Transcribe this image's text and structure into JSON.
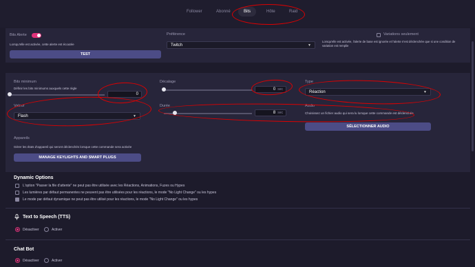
{
  "tabs": [
    {
      "label": "Follower",
      "active": false
    },
    {
      "label": "Abonné",
      "active": false
    },
    {
      "label": "Bits",
      "active": true
    },
    {
      "label": "Hôte",
      "active": false
    },
    {
      "label": "Raid",
      "active": false
    }
  ],
  "alert": {
    "title": "Bits Alerte",
    "enabled": true,
    "description": "Lorsqu'elle est activée, cette alerte est écoutée",
    "test_label": "TEST"
  },
  "preference": {
    "label": "Préférence",
    "value": "Twitch"
  },
  "variations": {
    "label": "Variations seulement",
    "checked": false,
    "description": "Lorsqu'elle est activée, l'alerte de base est ignorée et l'alerte n'est déclenchée que si une condition de variation est remplie"
  },
  "bits_min": {
    "label": "Bits minimum",
    "description": "Définir les bits minimums auxquels cette règle",
    "value": "0",
    "slider_fraction": 0.0
  },
  "offset": {
    "label": "Décalage",
    "value": "0",
    "unit": "sec",
    "slider_fraction": 0.0
  },
  "type": {
    "label": "Type",
    "value": "Réaction"
  },
  "valeur": {
    "label": "Valeur",
    "value": "Flash"
  },
  "duration": {
    "label": "Durée",
    "value": "8",
    "unit": "sec",
    "slider_fraction": 0.1
  },
  "audio": {
    "label": "Audio",
    "description": "Choisissez un fichier audio qui sera lu lorsque cette commande est déclenchée",
    "button_label": "SÉLECTIONNER AUDIO"
  },
  "devices": {
    "label": "Appareils",
    "description": "Gérer les états d'appareil qui seront déclenchés lorsque cette commande sera activée",
    "button_label": "MANAGE KEYLIGHTS AND SMART PLUGS"
  },
  "dynamic": {
    "title": "Dynamic Options",
    "options": [
      {
        "text": "L'option \"Passer la file d'attente\" ne peut pas être utilisée avec les Réactions, Animations, Fuzes ou Hypes",
        "checked": false
      },
      {
        "text": "Les lumières par défaut permanentes ne peuvent pas être utilisées pour les réactions, le mode \"No Light Change\" ou les hypes",
        "checked": false
      },
      {
        "text": "Le mode par défaut dynamique ne peut pas être utilisé pour les réactions, le mode \"No Light Change\" ou les hypes",
        "checked": true
      }
    ]
  },
  "tts": {
    "title": "Text to Speech (TTS)",
    "off_label": "Désactiver",
    "on_label": "Activer",
    "selected": "off"
  },
  "chatbot": {
    "title": "Chat Bot",
    "off_label": "Désactiver",
    "on_label": "Activer",
    "selected": "off"
  },
  "colors": {
    "background": "#1d1b2b",
    "panel": "#27253a",
    "accent": "#e0337a",
    "button": "#4c4c86",
    "annotation": "#e00000"
  }
}
